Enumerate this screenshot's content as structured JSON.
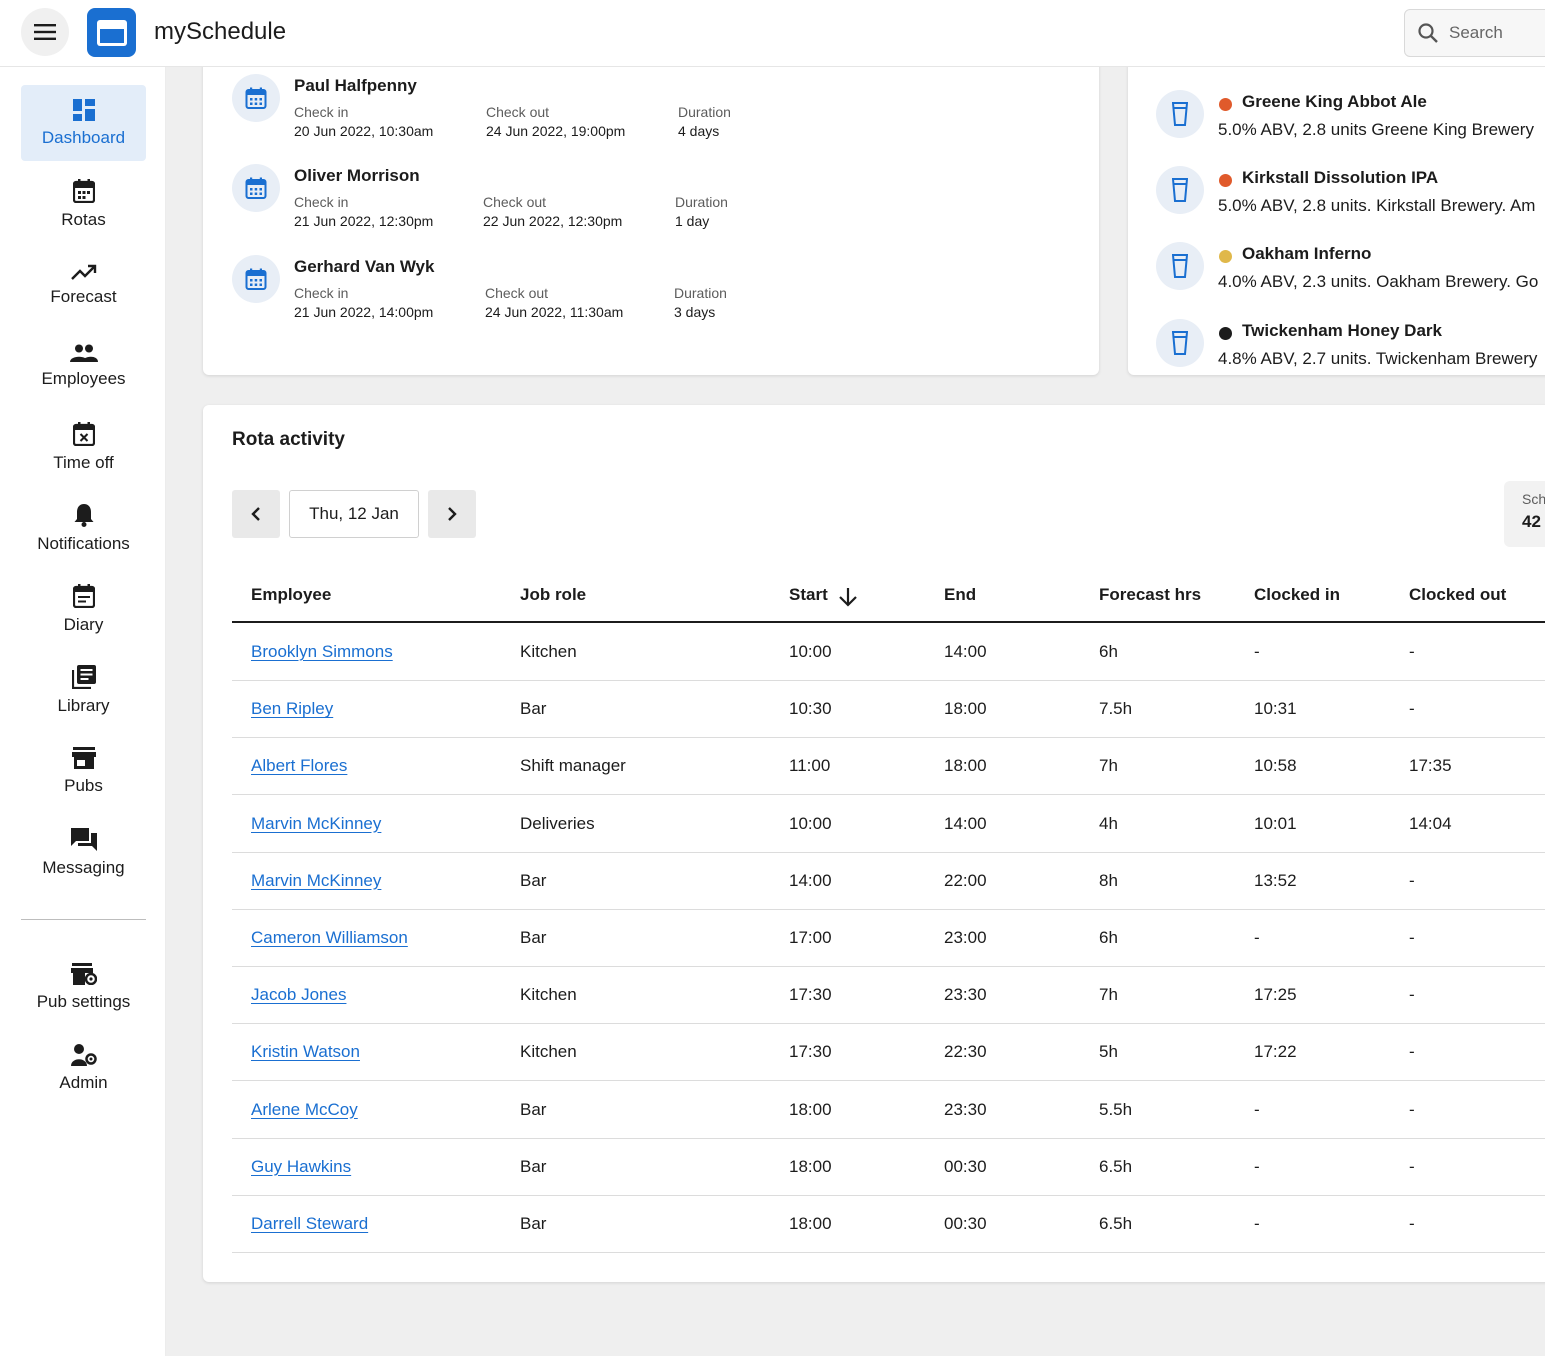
{
  "app": {
    "title": "mySchedule"
  },
  "search": {
    "placeholder": "Search"
  },
  "sidebar": {
    "items": [
      {
        "label": "Dashboard",
        "icon": "dashboard-icon",
        "active": true
      },
      {
        "label": "Rotas",
        "icon": "calendar-icon"
      },
      {
        "label": "Forecast",
        "icon": "trending-up-icon"
      },
      {
        "label": "Employees",
        "icon": "people-icon"
      },
      {
        "label": "Time off",
        "icon": "calendar-cancel-icon"
      },
      {
        "label": "Notifications",
        "icon": "bell-icon"
      },
      {
        "label": "Diary",
        "icon": "diary-icon"
      },
      {
        "label": "Library",
        "icon": "library-icon"
      },
      {
        "label": "Pubs",
        "icon": "store-icon"
      },
      {
        "label": "Messaging",
        "icon": "chat-icon"
      }
    ],
    "bottom_items": [
      {
        "label": "Pub settings",
        "icon": "store-settings-icon"
      },
      {
        "label": "Admin",
        "icon": "admin-icon"
      }
    ]
  },
  "stays": [
    {
      "name": "Paul Halfpenny",
      "check_in_label": "Check in",
      "check_in": "20 Jun 2022, 10:30am",
      "check_out_label": "Check out",
      "check_out": "24 Jun 2022, 19:00pm",
      "duration_label": "Duration",
      "duration": "4 days"
    },
    {
      "name": "Oliver Morrison",
      "check_in_label": "Check in",
      "check_in": "21 Jun 2022, 12:30pm",
      "check_out_label": "Check out",
      "check_out": "22 Jun 2022, 12:30pm",
      "duration_label": "Duration",
      "duration": "1 day"
    },
    {
      "name": "Gerhard Van Wyk",
      "check_in_label": "Check in",
      "check_in": "21 Jun 2022, 14:00pm",
      "check_out_label": "Check out",
      "check_out": "24 Jun 2022, 11:30am",
      "duration_label": "Duration",
      "duration": "3 days"
    }
  ],
  "beers": [
    {
      "name": "Greene King Abbot Ale",
      "desc": "5.0% ABV, 2.8 units Greene King Brewery",
      "color": "#e05a2b"
    },
    {
      "name": "Kirkstall Dissolution IPA",
      "desc": "5.0% ABV, 2.8 units. Kirkstall Brewery. Am",
      "color": "#e05a2b"
    },
    {
      "name": "Oakham Inferno",
      "desc": "4.0% ABV, 2.3 units. Oakham Brewery. Go",
      "color": "#e0b84a"
    },
    {
      "name": "Twickenham Honey Dark",
      "desc": "4.8% ABV, 2.7 units. Twickenham Brewery",
      "color": "#1c1c1c"
    }
  ],
  "rota": {
    "title": "Rota activity",
    "date": "Thu, 12 Jan",
    "scheduled_label": "Sch",
    "scheduled_value": "42",
    "columns": [
      "Employee",
      "Job role",
      "Start",
      "End",
      "Forecast hrs",
      "Clocked in",
      "Clocked out"
    ],
    "rows": [
      [
        "Brooklyn Simmons",
        "Kitchen",
        "10:00",
        "14:00",
        "6h",
        "-",
        "-"
      ],
      [
        "Ben Ripley",
        "Bar",
        "10:30",
        "18:00",
        "7.5h",
        "10:31",
        "-"
      ],
      [
        "Albert Flores",
        "Shift manager",
        "11:00",
        "18:00",
        "7h",
        "10:58",
        "17:35"
      ],
      [
        "Marvin McKinney",
        "Deliveries",
        "10:00",
        "14:00",
        "4h",
        "10:01",
        "14:04"
      ],
      [
        "Marvin McKinney",
        "Bar",
        "14:00",
        "22:00",
        "8h",
        "13:52",
        "-"
      ],
      [
        "Cameron Williamson",
        "Bar",
        "17:00",
        "23:00",
        "6h",
        "-",
        "-"
      ],
      [
        "Jacob Jones",
        "Kitchen",
        "17:30",
        "23:30",
        "7h",
        "17:25",
        "-"
      ],
      [
        "Kristin Watson",
        "Kitchen",
        "17:30",
        "22:30",
        "5h",
        "17:22",
        "-"
      ],
      [
        "Arlene McCoy",
        "Bar",
        "18:00",
        "23:30",
        "5.5h",
        "-",
        "-"
      ],
      [
        "Guy Hawkins",
        "Bar",
        "18:00",
        "00:30",
        "6.5h",
        "-",
        "-"
      ],
      [
        "Darrell Steward",
        "Bar",
        "18:00",
        "00:30",
        "6.5h",
        "-",
        "-"
      ]
    ]
  },
  "colors": {
    "accent": "#1a6fd1",
    "active_bg": "#e3edf9",
    "background": "#efefef"
  }
}
